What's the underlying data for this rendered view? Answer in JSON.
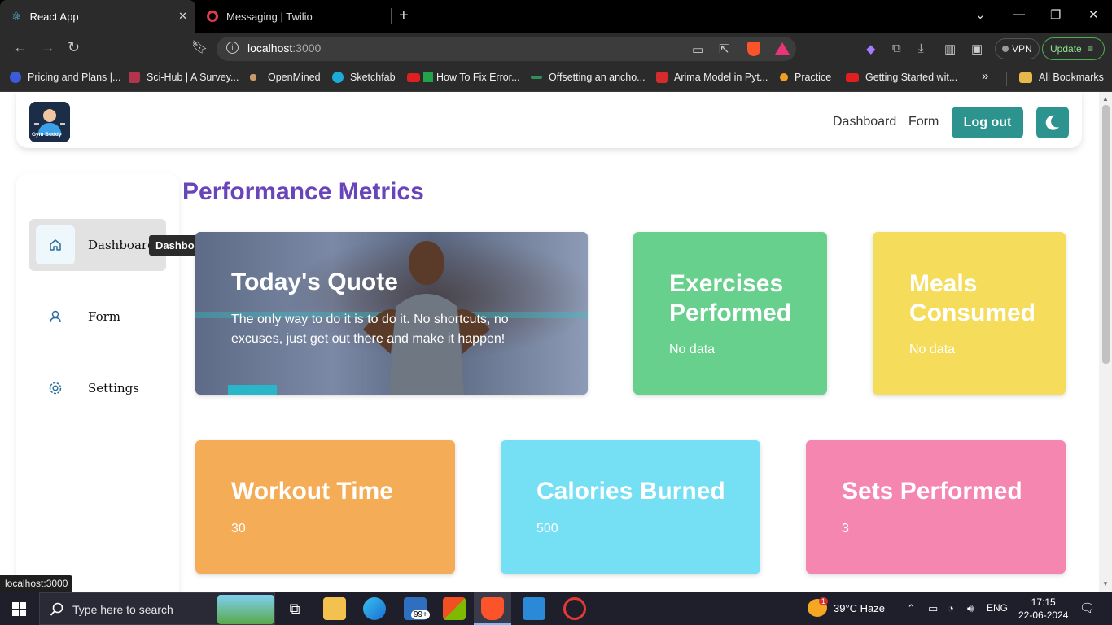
{
  "browser": {
    "tabs": [
      {
        "title": "React App",
        "active": true
      },
      {
        "title": "Messaging | Twilio",
        "active": false
      }
    ],
    "address": {
      "host": "localhost",
      "port": ":3000"
    },
    "vpn_label": "VPN",
    "update_label": "Update",
    "bookmarks": [
      {
        "label": "Pricing and Plans |...",
        "color": "#3b5bdb"
      },
      {
        "label": "Sci-Hub | A Survey...",
        "color": "#b3344d"
      },
      {
        "label": "OpenMined",
        "color": "#c99a6b"
      },
      {
        "label": "Sketchfab",
        "color": "#1caad9"
      },
      {
        "label": "How To Fix Error...",
        "color": "#22a34a"
      },
      {
        "label": "Offsetting an ancho...",
        "color": "#2f8f5b"
      },
      {
        "label": "Arima Model in Pyt...",
        "color": "#d62b2b"
      },
      {
        "label": "Practice",
        "color": "#f0a020"
      },
      {
        "label": "Getting Started wit...",
        "color": "#e02020"
      }
    ],
    "all_bookmarks_label": "All Bookmarks",
    "status_url": "localhost:3000"
  },
  "app": {
    "logo_text": "Gym Buddy",
    "nav": {
      "dashboard": "Dashboard",
      "form": "Form",
      "logout": "Log out"
    },
    "sidebar": [
      {
        "label": "Dashboard",
        "icon": "home-icon"
      },
      {
        "label": "Form",
        "icon": "user-icon"
      },
      {
        "label": "Settings",
        "icon": "gear-icon"
      }
    ],
    "tooltip": "Dashboard",
    "heading": "Performance Metrics",
    "quote": {
      "title": "Today's Quote",
      "text": "The only way to do it is to do it. No shortcuts, no excuses, just get out there and make it happen!"
    },
    "cards": {
      "exercises": {
        "title": "Exercises Performed",
        "value": "No data",
        "color": "#66d08c"
      },
      "meals": {
        "title": "Meals Consumed",
        "value": "No data",
        "color": "#f5dc5a"
      },
      "workout": {
        "title": "Workout Time",
        "value": "30",
        "color": "#f5ac56"
      },
      "calories": {
        "title": "Calories Burned",
        "value": "500",
        "color": "#75dff3"
      },
      "sets": {
        "title": "Sets Performed",
        "value": "3",
        "color": "#f486b0"
      }
    },
    "accent_color": "#2d938f",
    "heading_color": "#6a45b9"
  },
  "taskbar": {
    "search_placeholder": "Type here to search",
    "mail_badge": "99+",
    "weather_badge": "1",
    "weather": "39°C  Haze",
    "language": "ENG",
    "time": "17:15",
    "date": "22-06-2024"
  }
}
